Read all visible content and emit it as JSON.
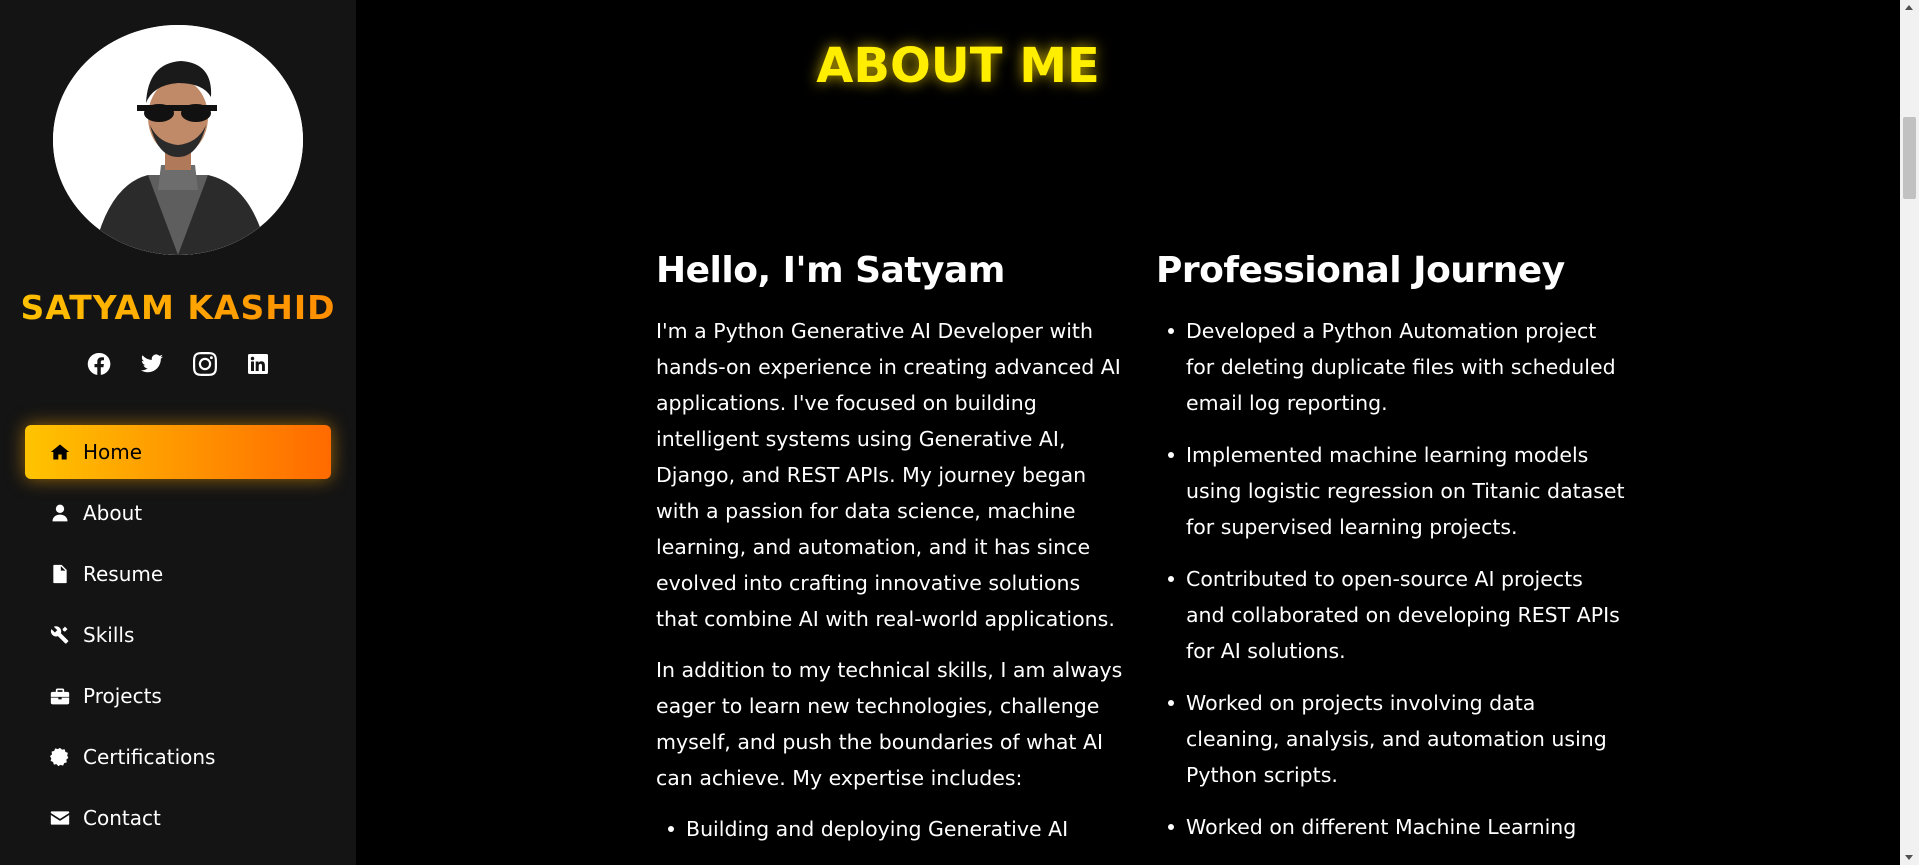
{
  "sidebar": {
    "brand": "SATYAM KASHID",
    "socials": [
      "facebook-icon",
      "twitter-icon",
      "instagram-icon",
      "linkedin-icon"
    ],
    "nav": [
      {
        "label": "Home",
        "icon": "home-icon",
        "active": true
      },
      {
        "label": "About",
        "icon": "user-icon",
        "active": false
      },
      {
        "label": "Resume",
        "icon": "file-icon",
        "active": false
      },
      {
        "label": "Skills",
        "icon": "tools-icon",
        "active": false
      },
      {
        "label": "Projects",
        "icon": "briefcase-icon",
        "active": false
      },
      {
        "label": "Certifications",
        "icon": "certificate-icon",
        "active": false
      },
      {
        "label": "Contact",
        "icon": "envelope-icon",
        "active": false
      }
    ]
  },
  "main": {
    "title": "ABOUT ME",
    "intro": {
      "heading": "Hello, I'm Satyam",
      "paragraphs": [
        "I'm a Python Generative AI Developer with hands-on experience in creating advanced AI applications. I've focused on building intelligent systems using Generative AI, Django, and REST APIs. My journey began with a passion for data science, machine learning, and automation, and it has since evolved into crafting innovative solutions that combine AI with real-world applications.",
        "In addition to my technical skills, I am always eager to learn new technologies, challenge myself, and push the boundaries of what AI can achieve. My expertise includes:"
      ],
      "expertise": [
        "Building and deploying Generative AI"
      ]
    },
    "journey": {
      "heading": "Professional Journey",
      "items": [
        "Developed a Python Automation project for deleting duplicate files with scheduled email log reporting.",
        "Implemented machine learning models using logistic regression on Titanic dataset for supervised learning projects.",
        "Contributed to open-source AI projects and collaborated on developing REST APIs for AI solutions.",
        "Worked on projects involving data cleaning, analysis, and automation using Python scripts.",
        "Worked on different Machine Learning"
      ]
    }
  },
  "colors": {
    "accent_gradient_start": "#ffc400",
    "accent_gradient_end": "#ff6a00",
    "title_yellow": "#ffee00",
    "sidebar_bg": "#141414",
    "page_bg": "#000000"
  }
}
